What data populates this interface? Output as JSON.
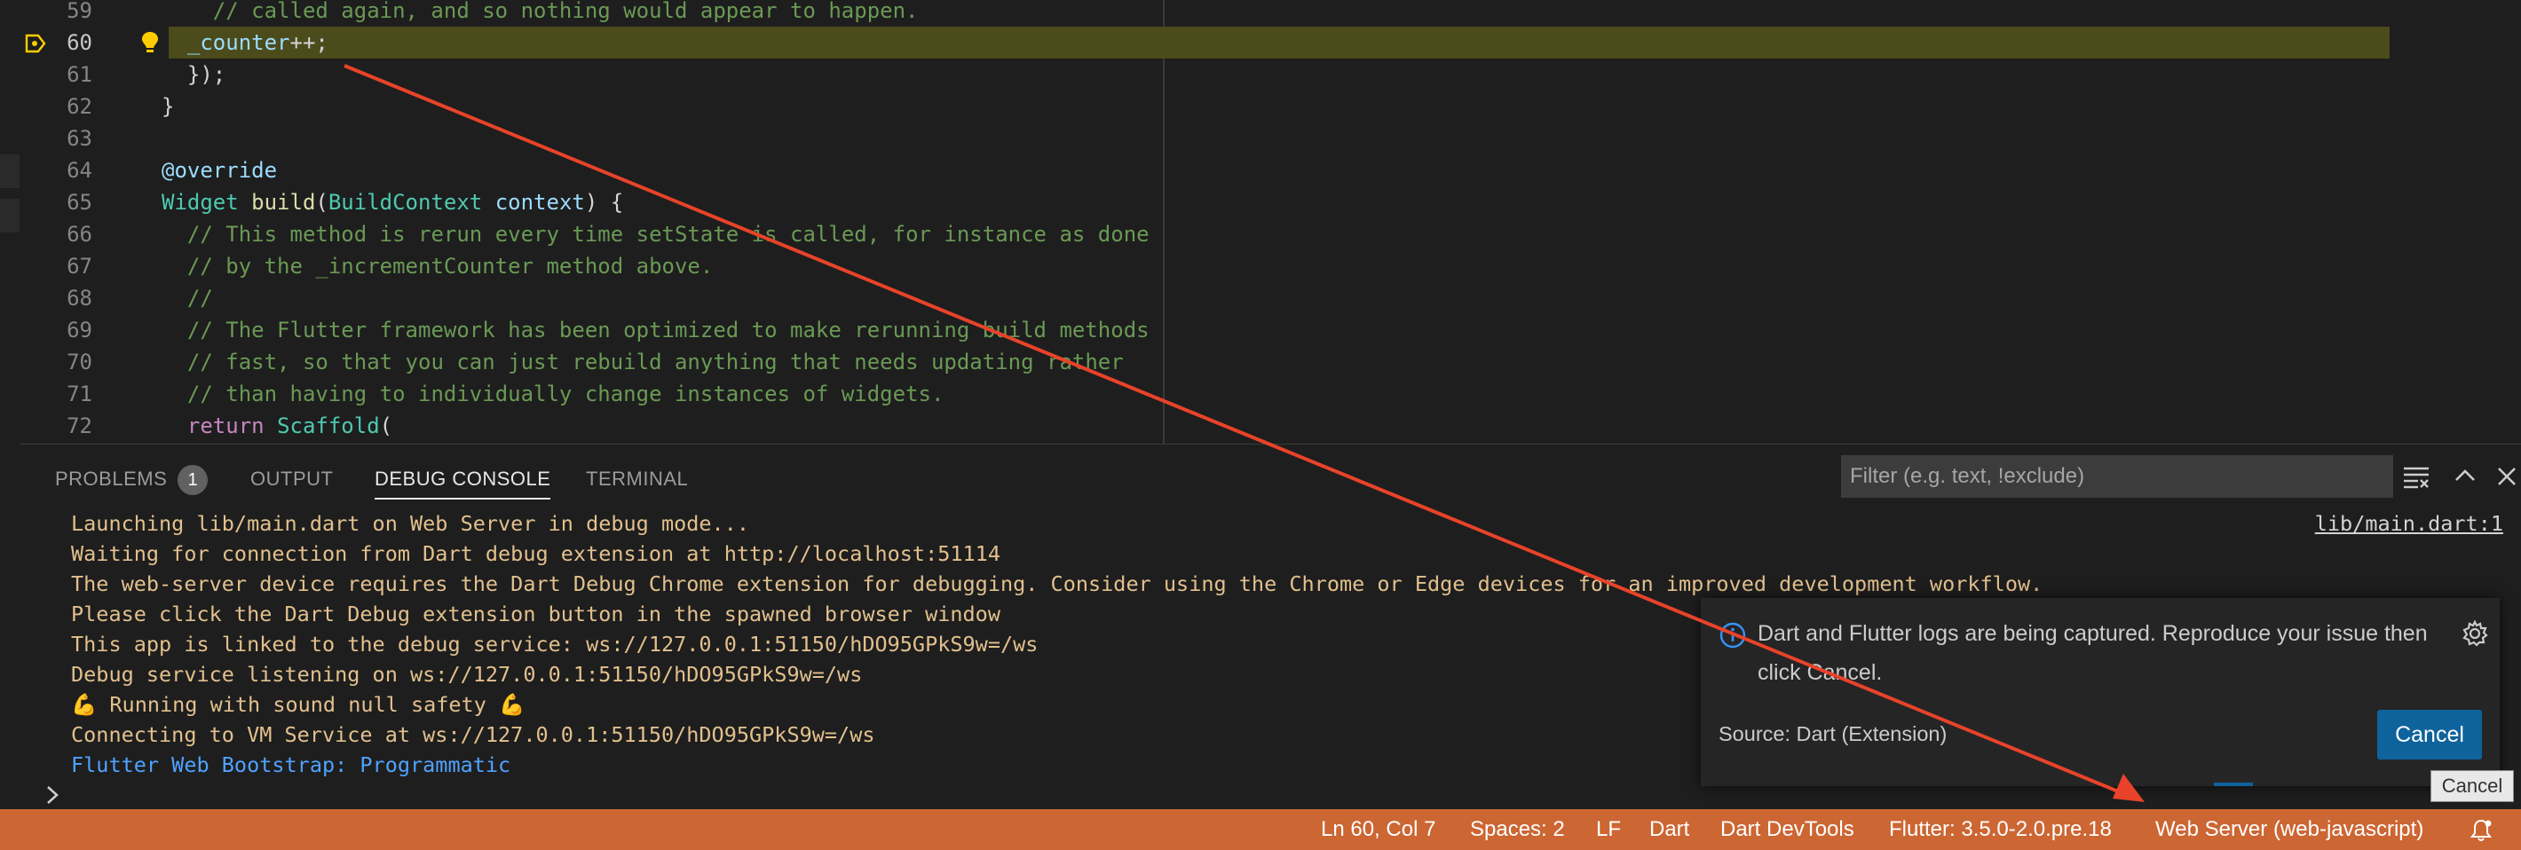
{
  "editor": {
    "lines": [
      {
        "num": "59",
        "segments": [
          {
            "t": "    ",
            "c": ""
          },
          {
            "t": "// called again, and so nothing would appear to happen.",
            "c": "c-com"
          }
        ]
      },
      {
        "num": "60",
        "segments": [
          {
            "t": "  ",
            "c": ""
          },
          {
            "t": "_counter",
            "c": "c-var"
          },
          {
            "t": "++;",
            "c": ""
          }
        ]
      },
      {
        "num": "61",
        "segments": [
          {
            "t": "  ",
            "c": ""
          },
          {
            "t": "});",
            "c": ""
          }
        ]
      },
      {
        "num": "62",
        "segments": [
          {
            "t": "}",
            "c": ""
          }
        ]
      },
      {
        "num": "63",
        "segments": []
      },
      {
        "num": "64",
        "segments": [
          {
            "t": "@override",
            "c": "c-dec"
          }
        ]
      },
      {
        "num": "65",
        "segments": [
          {
            "t": "Widget",
            "c": "c-type"
          },
          {
            "t": " ",
            "c": ""
          },
          {
            "t": "build",
            "c": "c-fn"
          },
          {
            "t": "(",
            "c": ""
          },
          {
            "t": "BuildContext",
            "c": "c-type"
          },
          {
            "t": " ",
            "c": ""
          },
          {
            "t": "context",
            "c": "c-var"
          },
          {
            "t": ") {",
            "c": ""
          }
        ]
      },
      {
        "num": "66",
        "segments": [
          {
            "t": "  ",
            "c": ""
          },
          {
            "t": "// This method is rerun every time setState is called, for instance as done",
            "c": "c-com"
          }
        ]
      },
      {
        "num": "67",
        "segments": [
          {
            "t": "  ",
            "c": ""
          },
          {
            "t": "// by the _incrementCounter method above.",
            "c": "c-com"
          }
        ]
      },
      {
        "num": "68",
        "segments": [
          {
            "t": "  ",
            "c": ""
          },
          {
            "t": "//",
            "c": "c-com"
          }
        ]
      },
      {
        "num": "69",
        "segments": [
          {
            "t": "  ",
            "c": ""
          },
          {
            "t": "// The Flutter framework has been optimized to make rerunning build methods",
            "c": "c-com"
          }
        ]
      },
      {
        "num": "70",
        "segments": [
          {
            "t": "  ",
            "c": ""
          },
          {
            "t": "// fast, so that you can just rebuild anything that needs updating rather",
            "c": "c-com"
          }
        ]
      },
      {
        "num": "71",
        "segments": [
          {
            "t": "  ",
            "c": ""
          },
          {
            "t": "// than having to individually change instances of widgets.",
            "c": "c-com"
          }
        ]
      },
      {
        "num": "72",
        "segments": [
          {
            "t": "  ",
            "c": ""
          },
          {
            "t": "return",
            "c": "c-kw"
          },
          {
            "t": " ",
            "c": ""
          },
          {
            "t": "Scaffold",
            "c": "c-type"
          },
          {
            "t": "(",
            "c": ""
          }
        ]
      }
    ]
  },
  "panel": {
    "tabs": {
      "problems": "PROBLEMS",
      "problems_count": "1",
      "output": "OUTPUT",
      "debug_console": "DEBUG CONSOLE",
      "terminal": "TERMINAL"
    },
    "filter_placeholder": "Filter (e.g. text, !exclude)"
  },
  "console": {
    "source_link": "lib/main.dart:1",
    "lines": [
      {
        "text": "Launching lib/main.dart on Web Server in debug mode...",
        "color": "yellow"
      },
      {
        "text": "Waiting for connection from Dart debug extension at http://localhost:51114",
        "color": "yellow"
      },
      {
        "text": "The web-server device requires the Dart Debug Chrome extension for debugging. Consider using the Chrome or Edge devices for an improved development workflow.",
        "color": "yellow"
      },
      {
        "text": "Please click the Dart Debug extension button in the spawned browser window",
        "color": "yellow"
      },
      {
        "text": "This app is linked to the debug service: ws://127.0.0.1:51150/hDO95GPkS9w=/ws",
        "color": "yellow"
      },
      {
        "text": "Debug service listening on ws://127.0.0.1:51150/hDO95GPkS9w=/ws",
        "color": "yellow"
      },
      {
        "text": "💪 Running with sound null safety 💪",
        "color": "yellow"
      },
      {
        "text": "Connecting to VM Service at ws://127.0.0.1:51150/hDO95GPkS9w=/ws",
        "color": "yellow"
      },
      {
        "text": "Flutter Web Bootstrap: Programmatic",
        "color": "blue"
      }
    ]
  },
  "notification": {
    "message": "Dart and Flutter logs are being captured. Reproduce your issue then click Cancel.",
    "source": "Source: Dart (Extension)",
    "button": "Cancel",
    "tooltip": "Cancel"
  },
  "statusbar": {
    "position": "Ln 60, Col 7",
    "spaces": "Spaces: 2",
    "eol": "LF",
    "language": "Dart",
    "devtools": "Dart DevTools",
    "flutter_version": "Flutter: 3.5.0-2.0.pre.18",
    "device": "Web Server (web-javascript)"
  },
  "colors": {
    "statusbar": "#cc6633",
    "arrow": "#e8432a",
    "console_text": "#e2c08d",
    "console_blue": "#4fa3ff",
    "button": "#0e639c"
  }
}
